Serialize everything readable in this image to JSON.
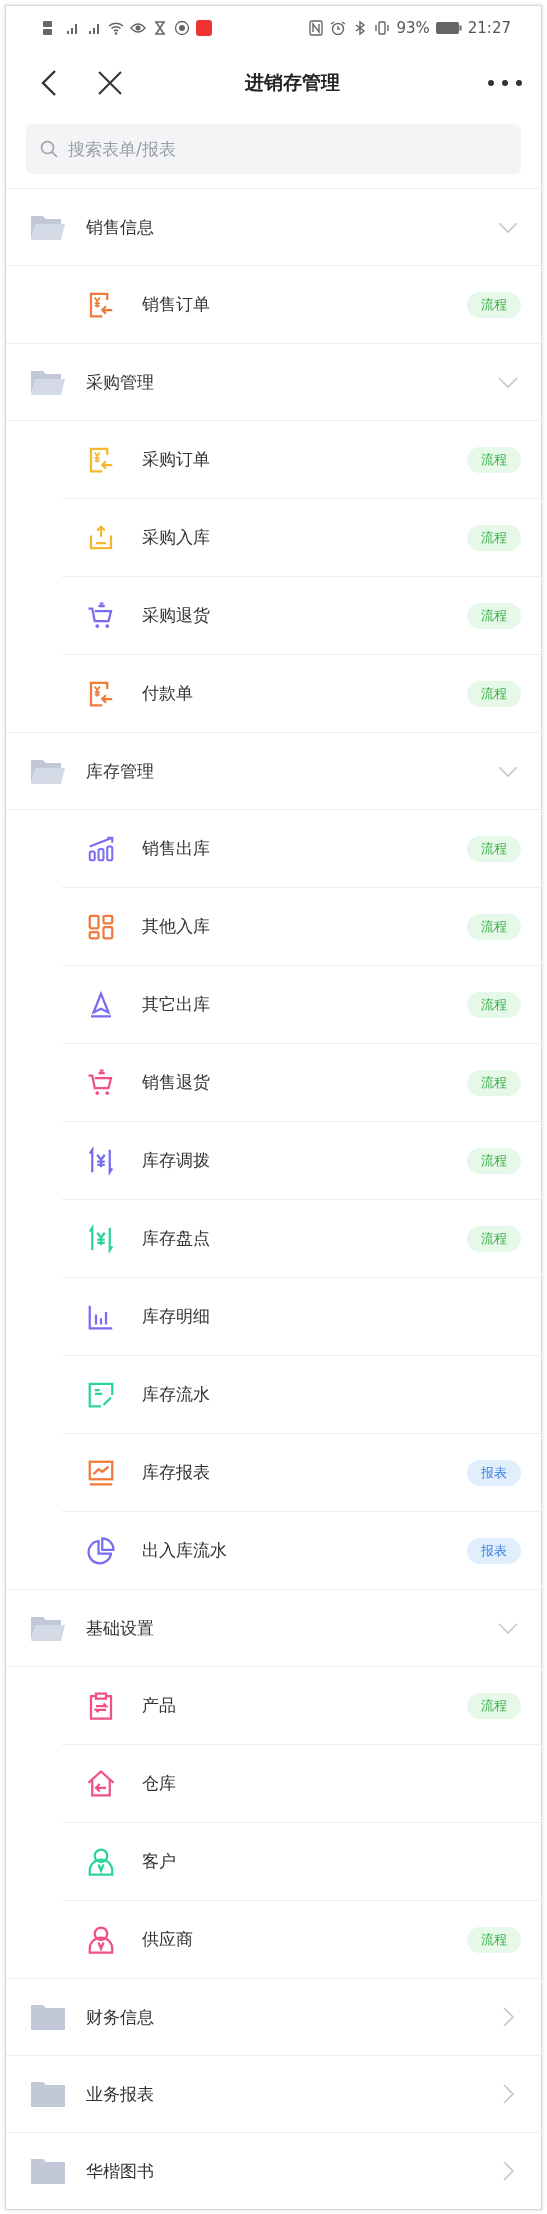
{
  "status_bar": {
    "battery": "93%",
    "time": "21:27"
  },
  "header": {
    "title": "进销存管理"
  },
  "search": {
    "placeholder": "搜索表单/报表"
  },
  "sections": [
    {
      "title": "销售信息",
      "expanded": true,
      "items": [
        {
          "label": "销售订单",
          "kind": "yen-doc",
          "color": "#f07a3a",
          "tag": {
            "text": "流程",
            "kind": "flow"
          }
        }
      ]
    },
    {
      "title": "采购管理",
      "expanded": true,
      "items": [
        {
          "label": "采购订单",
          "kind": "yen-doc",
          "color": "#f5b82e",
          "tag": {
            "text": "流程",
            "kind": "flow"
          }
        },
        {
          "label": "采购入库",
          "kind": "tray",
          "color": "#f5b82e",
          "tag": {
            "text": "流程",
            "kind": "flow"
          }
        },
        {
          "label": "采购退货",
          "kind": "cart",
          "color": "#7a6cf0",
          "tag": {
            "text": "流程",
            "kind": "flow"
          }
        },
        {
          "label": "付款单",
          "kind": "yen-doc",
          "color": "#f07a3a",
          "tag": {
            "text": "流程",
            "kind": "flow"
          }
        }
      ]
    },
    {
      "title": "库存管理",
      "expanded": true,
      "items": [
        {
          "label": "销售出库",
          "kind": "growth",
          "color": "#7a6cf0",
          "tag": {
            "text": "流程",
            "kind": "flow"
          }
        },
        {
          "label": "其他入库",
          "kind": "grid",
          "color": "#f07a3a",
          "tag": {
            "text": "流程",
            "kind": "flow"
          }
        },
        {
          "label": "其它出库",
          "kind": "triangle",
          "color": "#7a6cf0",
          "tag": {
            "text": "流程",
            "kind": "flow"
          }
        },
        {
          "label": "销售退货",
          "kind": "cart",
          "color": "#f0508a",
          "tag": {
            "text": "流程",
            "kind": "flow"
          }
        },
        {
          "label": "库存调拨",
          "kind": "yen-bracket",
          "color": "#7a6cf0",
          "tag": {
            "text": "流程",
            "kind": "flow"
          }
        },
        {
          "label": "库存盘点",
          "kind": "yen-bracket",
          "color": "#2ed39a",
          "tag": {
            "text": "流程",
            "kind": "flow"
          }
        },
        {
          "label": "库存明细",
          "kind": "bars",
          "color": "#7a6cf0"
        },
        {
          "label": "库存流水",
          "kind": "note",
          "color": "#2ed39a"
        },
        {
          "label": "库存报表",
          "kind": "monitor",
          "color": "#f07a3a",
          "tag": {
            "text": "报表",
            "kind": "report"
          }
        },
        {
          "label": "出入库流水",
          "kind": "pie",
          "color": "#7a6cf0",
          "tag": {
            "text": "报表",
            "kind": "report"
          }
        }
      ]
    },
    {
      "title": "基础设置",
      "expanded": true,
      "items": [
        {
          "label": "产品",
          "kind": "clipboard",
          "color": "#f0508a",
          "tag": {
            "text": "流程",
            "kind": "flow"
          }
        },
        {
          "label": "仓库",
          "kind": "house",
          "color": "#f0508a"
        },
        {
          "label": "客户",
          "kind": "person",
          "color": "#2ed39a"
        },
        {
          "label": "供应商",
          "kind": "person",
          "color": "#f0508a",
          "tag": {
            "text": "流程",
            "kind": "flow"
          }
        }
      ]
    },
    {
      "title": "财务信息",
      "expanded": false
    },
    {
      "title": "业务报表",
      "expanded": false
    },
    {
      "title": "华楷图书",
      "expanded": false
    }
  ]
}
